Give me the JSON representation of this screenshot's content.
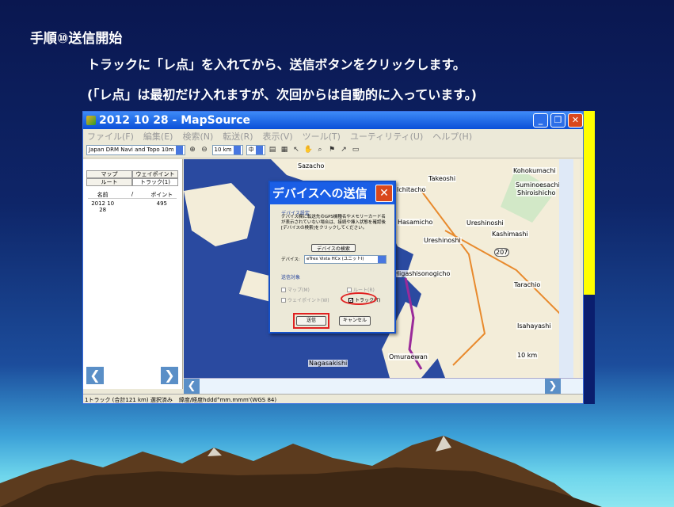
{
  "slide": {
    "heading": "手順⑩送信開始",
    "instruction1": "トラックに「レ点」を入れてから、送信ボタンをクリックします。",
    "instruction2": "(「レ点」は最初だけ入れますが、次回からは自動的に入っています。)"
  },
  "app": {
    "title": "2012 10 28 - MapSource",
    "window_buttons": {
      "minimize": "_",
      "restore": "❐",
      "close": "✕"
    },
    "menu": [
      "ファイル(F)",
      "編集(E)",
      "検索(N)",
      "転送(R)",
      "表示(V)",
      "ツール(T)",
      "ユーティリティ(U)",
      "ヘルプ(H)"
    ],
    "toolbar": {
      "map_product": "Japan DRM Navi and Topo 10m",
      "zoom": "10 km",
      "layer": "中"
    },
    "tabs": {
      "maps": "マップ",
      "waypoints": "ウェイポイント",
      "routes": "ルート",
      "tracks": "トラック(1)"
    },
    "list_headers": {
      "name": "名前",
      "sort": "/",
      "points": "ポイント"
    },
    "list_rows": [
      {
        "name": "2012 10 28",
        "points": "495"
      }
    ],
    "status": {
      "summary": "1トラック (合計121 km) 選択済み",
      "format": "緯度/経度hddd°mm.mmm'(WGS 84)"
    },
    "map_labels": [
      "Sazacho",
      "Takeoshi",
      "Kohokumachi",
      "Suminoesachi",
      "Shiroishicho",
      "Ichitacho",
      "Hasamicho",
      "Ureshinoshi",
      "Kashimashi",
      "Ureshinoshi",
      "Higashisonogicho",
      "Tarachio",
      "Isahayashi",
      "Nagasakishi",
      "Omuraewan",
      "10 km",
      "207"
    ]
  },
  "dialog": {
    "title": "デバイスへの送信",
    "close": "✕",
    "section_device": "デバイス設定",
    "help_text": "デバイス欄に転送先のGPS機種名やメモリーカード名が表示されていない場合は、接続や挿入状態を確認後[デバイスの検索]をクリックしてください。",
    "search_button": "デバイスの検索",
    "device_label": "デバイス:",
    "device_value": "eTrex Vista HCx (ユニットI)",
    "section_items": "送信対象",
    "opt_maps": "マップ(M)",
    "opt_routes": "ルート(R)",
    "opt_waypoints": "ウェイポイント(W)",
    "opt_tracks": "トラック(T)",
    "send_button": "送信",
    "cancel_button": "キャンセル"
  }
}
